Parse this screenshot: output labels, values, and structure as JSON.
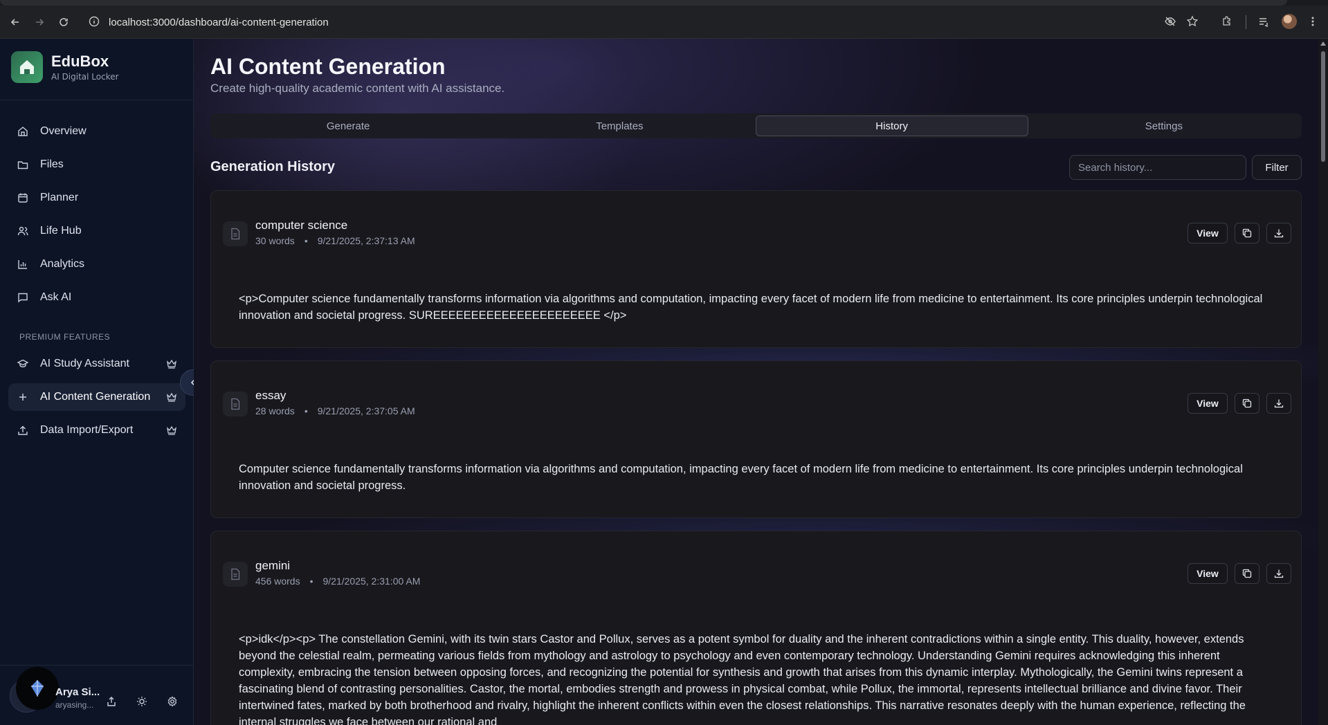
{
  "browser": {
    "url": "localhost:3000/dashboard/ai-content-generation"
  },
  "brand": {
    "name": "EduBox",
    "subtitle": "AI Digital Locker"
  },
  "sidebar": {
    "items": [
      {
        "label": "Overview",
        "icon": "home-icon"
      },
      {
        "label": "Files",
        "icon": "folder-icon"
      },
      {
        "label": "Planner",
        "icon": "calendar-icon"
      },
      {
        "label": "Life Hub",
        "icon": "users-icon"
      },
      {
        "label": "Analytics",
        "icon": "bar-chart-icon"
      },
      {
        "label": "Ask AI",
        "icon": "message-icon"
      }
    ],
    "section_label": "PREMIUM FEATURES",
    "premium_items": [
      {
        "label": "AI Study Assistant",
        "icon": "graduation-cap-icon",
        "active": false
      },
      {
        "label": "AI Content Generation",
        "icon": "plus-icon",
        "active": true
      },
      {
        "label": "Data Import/Export",
        "icon": "upload-icon",
        "active": false
      }
    ]
  },
  "user": {
    "name": "Arya Si...",
    "email": "aryasing..."
  },
  "header": {
    "title": "AI Content Generation",
    "subtitle": "Create high-quality academic content with AI assistance."
  },
  "tabs": [
    {
      "label": "Generate",
      "active": false
    },
    {
      "label": "Templates",
      "active": false
    },
    {
      "label": "History",
      "active": true
    },
    {
      "label": "Settings",
      "active": false
    }
  ],
  "history": {
    "title": "Generation History",
    "search_placeholder": "Search history...",
    "filter_label": "Filter",
    "view_label": "View",
    "items": [
      {
        "title": "computer science",
        "words": "30 words",
        "timestamp": "9/21/2025, 2:37:13 AM",
        "content": "<p>Computer science fundamentally transforms information via algorithms and computation, impacting every facet of modern life from medicine to entertainment. Its core principles underpin technological innovation and societal progress. SUREEEEEEEEEEEEEEEEEEEEEE </p>"
      },
      {
        "title": "essay",
        "words": "28 words",
        "timestamp": "9/21/2025, 2:37:05 AM",
        "content": "Computer science fundamentally transforms information via algorithms and computation, impacting every facet of modern life from medicine to entertainment. Its core principles underpin technological innovation and societal progress."
      },
      {
        "title": "gemini",
        "words": "456 words",
        "timestamp": "9/21/2025, 2:31:00 AM",
        "content": "<p>idk</p><p> The constellation Gemini, with its twin stars Castor and Pollux, serves as a potent symbol for duality and the inherent contradictions within a single entity. This duality, however, extends beyond the celestial realm, permeating various fields from mythology and astrology to psychology and even contemporary technology. Understanding Gemini requires acknowledging this inherent complexity, embracing the tension between opposing forces, and recognizing the potential for synthesis and growth that arises from this dynamic interplay. Mythologically, the Gemini twins represent a fascinating blend of contrasting personalities. Castor, the mortal, embodies strength and prowess in physical combat, while Pollux, the immortal, represents intellectual brilliance and divine favor. Their intertwined fates, marked by both brotherhood and rivalry, highlight the inherent conflicts within even the closest relationships. This narrative resonates deeply with the human experience, reflecting the internal struggles we face between our rational and"
      }
    ]
  },
  "colors": {
    "accent": "#2563eb",
    "sidebar_bg": "#0d1426",
    "card_bg": "#18181d"
  }
}
